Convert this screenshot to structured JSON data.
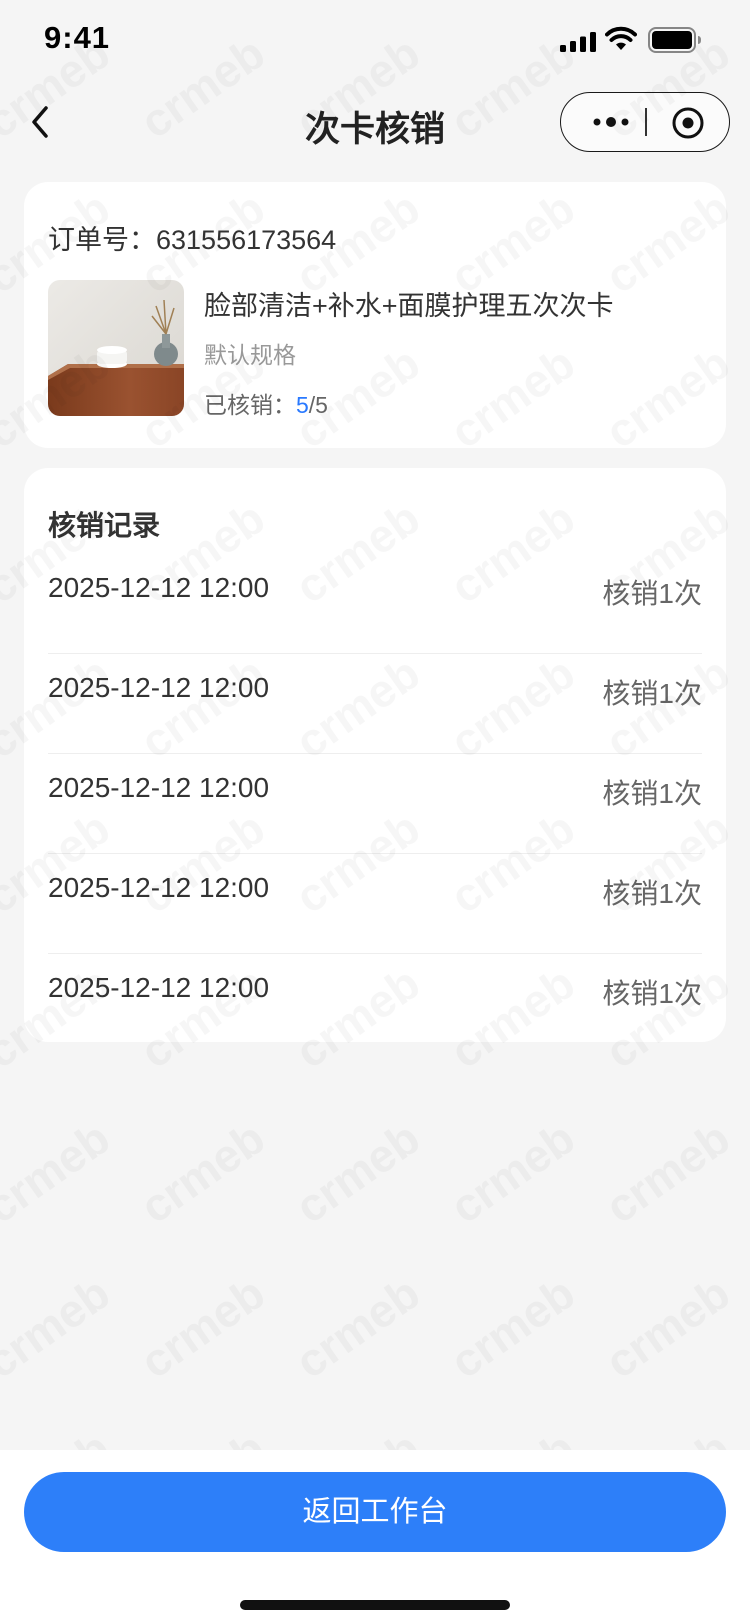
{
  "status_bar": {
    "time": "9:41"
  },
  "nav": {
    "title": "次卡核销"
  },
  "order": {
    "label": "订单号：",
    "number": "631556173564",
    "product_name": "脸部清洁+补水+面膜护理五次次卡",
    "spec": "默认规格",
    "verified_label": "已核销：",
    "verified_done": "5",
    "verified_total": "/5"
  },
  "records": {
    "title": "核销记录",
    "items": [
      {
        "time": "2025-12-12 12:00",
        "count": "核销1次"
      },
      {
        "time": "2025-12-12 12:00",
        "count": "核销1次"
      },
      {
        "time": "2025-12-12 12:00",
        "count": "核销1次"
      },
      {
        "time": "2025-12-12 12:00",
        "count": "核销1次"
      },
      {
        "time": "2025-12-12 12:00",
        "count": "核销1次"
      }
    ]
  },
  "footer": {
    "button_label": "返回工作台"
  },
  "watermark": {
    "text": "crmeb"
  },
  "colors": {
    "accent": "#2d7ff9",
    "progress": "#2979ff",
    "background": "#f5f5f5"
  },
  "icons": [
    "signal-icon",
    "wifi-icon",
    "battery-icon",
    "back-icon",
    "more-icon",
    "close-icon"
  ]
}
